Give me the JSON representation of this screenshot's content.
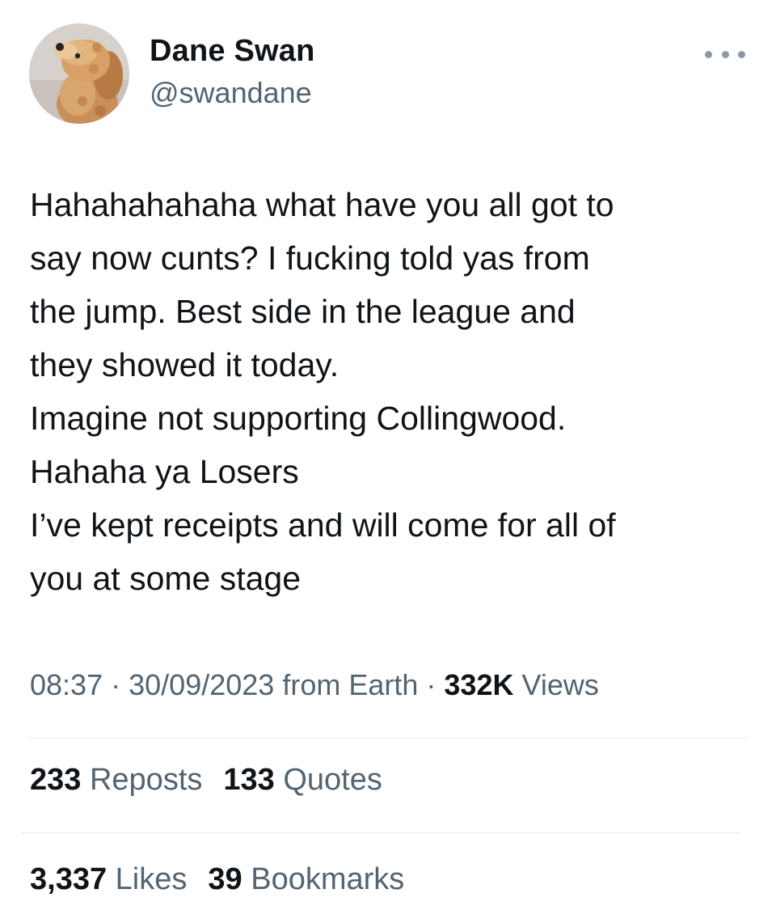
{
  "author": {
    "display_name": "Dane Swan",
    "handle": "@swandane",
    "avatar_icon": "dog-avatar-photo"
  },
  "tweet": {
    "lines": [
      "Hahahahahaha what have you all got to",
      "say now cunts? I fucking told yas from",
      "the jump. Best side in the league and",
      "they showed it today.",
      "Imagine not supporting Collingwood.",
      "Hahaha ya Losers",
      "I’ve kept receipts and will come for all of",
      "you at some stage"
    ]
  },
  "meta": {
    "time": "08:37",
    "separator": "·",
    "date": "30/09/2023",
    "source": "from Earth",
    "views_count": "332K",
    "views_label": "Views"
  },
  "stats": {
    "reposts_count": "233",
    "reposts_label": "Reposts",
    "quotes_count": "133",
    "quotes_label": "Quotes",
    "likes_count": "3,337",
    "likes_label": "Likes",
    "bookmarks_count": "39",
    "bookmarks_label": "Bookmarks"
  },
  "colors": {
    "text_primary": "#0f1419",
    "text_secondary": "#536471",
    "divider": "#e1e8ed",
    "more_icon": "#8b98a5"
  },
  "icons": {
    "more": "more-horizontal-icon"
  }
}
